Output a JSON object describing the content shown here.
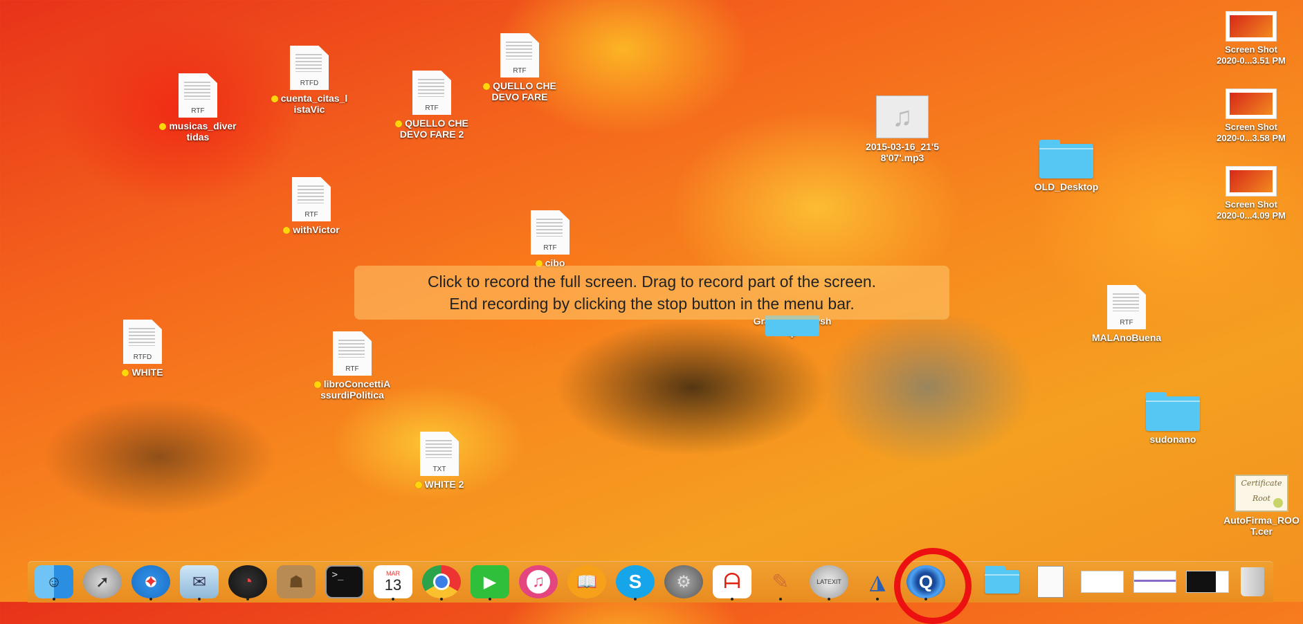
{
  "hud": {
    "line1": "Click to record the full screen. Drag to record part of the screen.",
    "line2": "End recording by clicking the stop button in the menu bar."
  },
  "desktop": {
    "musicas": {
      "ext": "RTF",
      "name": "musicas_diver\ntidas"
    },
    "cuenta": {
      "ext": "RTFD",
      "name": "cuenta_citas_l\nistaVic"
    },
    "quello2": {
      "ext": "RTF",
      "name": "QUELLO CHE\nDEVO FARE 2"
    },
    "quello": {
      "ext": "RTF",
      "name": "QUELLO CHE\nDEVO FARE"
    },
    "withvictor": {
      "ext": "RTF",
      "name": "withVictor"
    },
    "cibo": {
      "ext": "RTF",
      "name": "cibo"
    },
    "white": {
      "ext": "RTFD",
      "name": "WHITE"
    },
    "libro": {
      "ext": "RTF",
      "name": "libroConcettiA\nssurdiPolitica"
    },
    "white2": {
      "ext": "TXT",
      "name": "WHITE 2"
    },
    "mp3": {
      "name": "2015-03-16_21'5\n8'07'.mp3"
    },
    "grants": {
      "name": "Grants_Fellowsh\nip"
    },
    "old_desktop": {
      "name": "OLD_Desktop"
    },
    "malano": {
      "ext": "RTF",
      "name": "MALAnoBuena"
    },
    "sudonano": {
      "name": "sudonano"
    },
    "autofirma": {
      "name": "AutoFirma_ROO\nT.cer",
      "cert_text": "Certificate\nRoot"
    },
    "shot1": {
      "name": "Screen Shot\n2020-0...3.51 PM"
    },
    "shot2": {
      "name": "Screen Shot\n2020-0...3.58 PM"
    },
    "shot3": {
      "name": "Screen Shot\n2020-0...4.09 PM"
    }
  },
  "dock": {
    "calendar_month": "MAR",
    "calendar_day": "13",
    "terminal_prompt": ">_",
    "latex_label": "LATEXIT",
    "items": [
      "finder",
      "launchpad",
      "safari",
      "mail",
      "dashboard",
      "contacts",
      "terminal",
      "calendar",
      "chrome",
      "facetime",
      "itunes",
      "ibooks",
      "skype",
      "system-preferences",
      "acrobat",
      "texshop",
      "latexit",
      "matlab",
      "quicktime",
      "folder",
      "preview",
      "screenshot",
      "screenshot",
      "screenshot",
      "trash"
    ]
  },
  "colors": {
    "tag_yellow": "#ffd60a",
    "folder_blue": "#56c6f2",
    "highlight_ring": "#ec1010"
  }
}
